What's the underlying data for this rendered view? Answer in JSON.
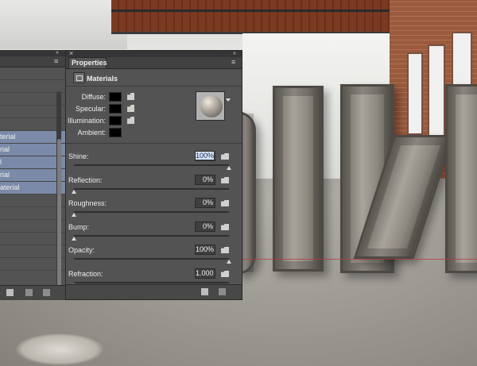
{
  "properties_panel": {
    "tab_label": "Properties",
    "section_title": "Materials",
    "close_glyph": "×",
    "collapse_glyph": "»",
    "menu_glyph": "≡",
    "swatches": [
      {
        "label": "Diffuse:",
        "color": "#000000"
      },
      {
        "label": "Specular:",
        "color": "#000000"
      },
      {
        "label": "Illumination:",
        "color": "#000000"
      },
      {
        "label": "Ambient:",
        "color": "#000000"
      }
    ],
    "properties": [
      {
        "label": "Shine:",
        "value": "100%",
        "slider_fraction": 1.0,
        "selected": true
      },
      {
        "label": "Reflection:",
        "value": "0%",
        "slider_fraction": 0.0
      },
      {
        "label": "Roughness:",
        "value": "0%",
        "slider_fraction": 0.0
      },
      {
        "label": "Bump:",
        "value": "0%",
        "slider_fraction": 0.0
      },
      {
        "label": "Opacity:",
        "value": "100%",
        "slider_fraction": 1.0
      },
      {
        "label": "Refraction:",
        "value": "1.000",
        "slider_fraction": 0.0
      }
    ]
  },
  "left_panel": {
    "collapse_glyph": "»",
    "menu_glyph": "≡",
    "rows": [
      {
        "label": "",
        "selected": false
      },
      {
        "label": "",
        "selected": false
      },
      {
        "label": "",
        "selected": false
      },
      {
        "label": "",
        "selected": false
      },
      {
        "label": "",
        "selected": false
      },
      {
        "label": "terial",
        "selected": true
      },
      {
        "label": "rial",
        "selected": true
      },
      {
        "label": "l",
        "selected": true
      },
      {
        "label": "rial",
        "selected": true
      },
      {
        "label": "aterial",
        "selected": true
      },
      {
        "label": "",
        "selected": false
      },
      {
        "label": "",
        "selected": false
      },
      {
        "label": "",
        "selected": false
      },
      {
        "label": "",
        "selected": false
      },
      {
        "label": "",
        "selected": false
      },
      {
        "label": "",
        "selected": false
      }
    ]
  }
}
